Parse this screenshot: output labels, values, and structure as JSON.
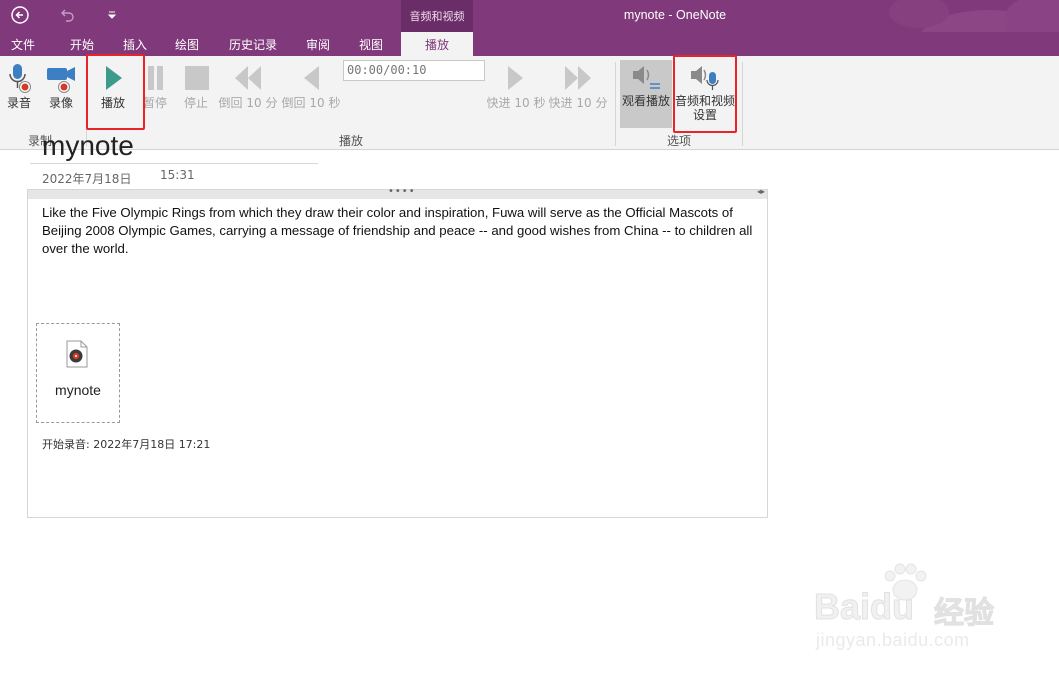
{
  "titlebar": {
    "contextual_group": "音频和视频",
    "window_title": "mynote - OneNote"
  },
  "tabs": [
    {
      "label": "文件"
    },
    {
      "label": "开始"
    },
    {
      "label": "插入"
    },
    {
      "label": "绘图"
    },
    {
      "label": "历史记录"
    },
    {
      "label": "审阅"
    },
    {
      "label": "视图"
    },
    {
      "label": "播放",
      "active": true
    }
  ],
  "ribbon": {
    "record_group": {
      "label": "录制",
      "record_audio": "录音",
      "record_video": "录像"
    },
    "playback_group": {
      "label": "播放",
      "play": "播放",
      "pause": "暂停",
      "stop": "停止",
      "rewind_10min": "倒回 10 分",
      "rewind_10sec": "倒回 10 秒",
      "time_display": "00:00/00:10",
      "forward_10sec": "快进 10 秒",
      "forward_10min": "快进 10 分"
    },
    "options_group": {
      "label": "选项",
      "see_playback": "观看播放",
      "av_settings_line1": "音频和视频",
      "av_settings_line2": "设置"
    }
  },
  "page": {
    "title": "mynote",
    "date": "2022年7月18日",
    "time": "15:31",
    "paragraph": "Like the Five Olympic Rings from which they draw their color and inspiration, Fuwa will serve as the Official Mascots of Beijing 2008 Olympic Games, carrying a message of friendship and peace -- and good wishes from China -- to children all over the world.",
    "attachment_name": "mynote",
    "recording_started": "开始录音: 2022年7月18日 17:21"
  },
  "watermark": {
    "brand": "Baidu",
    "brand_suffix": "经验",
    "url": "jingyan.baidu.com"
  },
  "colors": {
    "accent": "#80397b",
    "highlight_box": "#e8232a",
    "play_icon": "#3d9b8b"
  }
}
